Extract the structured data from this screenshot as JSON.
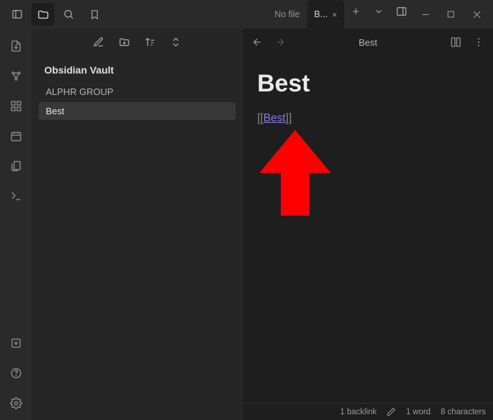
{
  "titlebar": {
    "tab_inactive": "No file",
    "tab_active": "B...",
    "tab_close": "×"
  },
  "sidebar": {
    "vault_name": "Obsidian Vault",
    "items": [
      {
        "label": "ALPHR GROUP"
      },
      {
        "label": "Best"
      }
    ]
  },
  "editor": {
    "header_title": "Best",
    "note_heading": "Best",
    "link": {
      "open": "[[",
      "text": "Best",
      "close": "]]"
    }
  },
  "status": {
    "backlinks": "1 backlink",
    "words": "1 word",
    "characters": "8 characters"
  },
  "colors": {
    "link": "#8c7ae6",
    "arrow": "#fe0000"
  }
}
